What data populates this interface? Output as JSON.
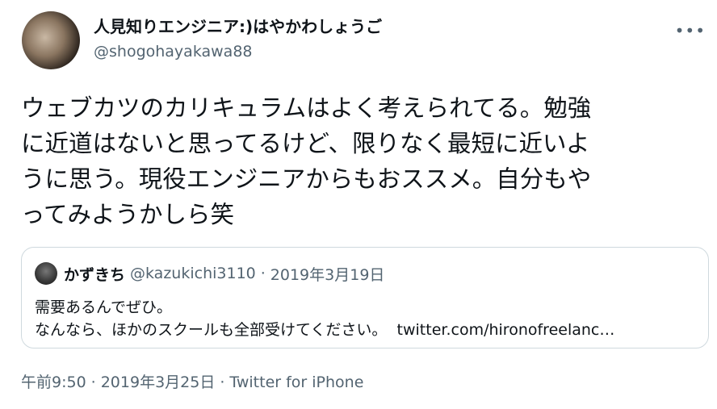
{
  "author": {
    "display_name": "人見知りエンジニア:)はやかわしょうご",
    "handle": "@shogohayakawa88"
  },
  "menu": {
    "more_label": "•••",
    "more_icon": "more-icon"
  },
  "tweet": {
    "text": "ウェブカツのカリキュラムはよく考えられてる。勉強\nに近道はないと思ってるけど、限りなく最短に近いよ\nうに思う。現役エンジニアからもおススメ。自分もや\nってみようかしら笑"
  },
  "quote": {
    "name": "かずきち",
    "handle": "@kazukichi3110",
    "separator": "·",
    "date": "2019年3月19日",
    "line1": "需要あるんでぜひ。",
    "line2": "なんなら、ほかのスクールも全部受けてください。",
    "link": "twitter.com/hironofreelanc…"
  },
  "meta": {
    "time": "午前9:50",
    "separator": "·",
    "date": "2019年3月25日",
    "source": "Twitter for iPhone"
  },
  "colors": {
    "text": "#0f1419",
    "secondary": "#536471",
    "border": "#cfd9de"
  }
}
